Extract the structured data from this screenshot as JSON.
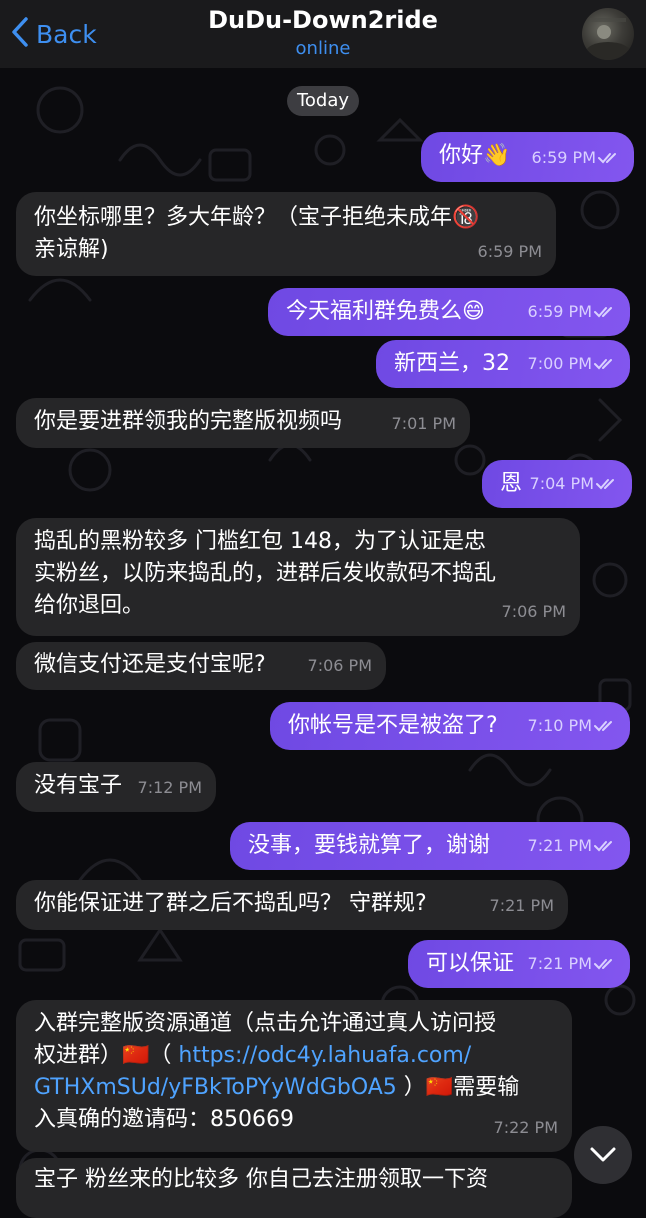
{
  "header": {
    "back_label": "Back",
    "title": "DuDu-Down2ride",
    "status": "online"
  },
  "date_separator": "Today",
  "messages": [
    {
      "dir": "out",
      "text": "你好👋",
      "time": "6:59 PM"
    },
    {
      "dir": "in",
      "text": "你坐标哪里？多大年龄？（宝子拒绝未成年🔞\n亲谅解)",
      "time": "6:59 PM"
    },
    {
      "dir": "out",
      "text": "今天福利群免费么😄",
      "time": "6:59 PM"
    },
    {
      "dir": "out",
      "text": "新西兰，32",
      "time": "7:00 PM"
    },
    {
      "dir": "in",
      "text": "你是要进群领我的完整版视频吗",
      "time": "7:01 PM"
    },
    {
      "dir": "out",
      "text": "恩",
      "time": "7:04 PM"
    },
    {
      "dir": "in",
      "text": "捣乱的黑粉较多 门槛红包 148，为了认证是忠\n实粉丝，以防来捣乱的，进群后发收款码不捣乱\n给你退回。",
      "time": "7:06 PM"
    },
    {
      "dir": "in",
      "text": "微信支付还是支付宝呢?",
      "time": "7:06 PM"
    },
    {
      "dir": "out",
      "text": "你帐号是不是被盗了?",
      "time": "7:10 PM"
    },
    {
      "dir": "in",
      "text": "没有宝子",
      "time": "7:12 PM"
    },
    {
      "dir": "out",
      "text": "没事，要钱就算了，谢谢",
      "time": "7:21 PM"
    },
    {
      "dir": "in",
      "text": "你能保证进了群之后不捣乱吗？ 守群规?",
      "time": "7:21 PM"
    },
    {
      "dir": "out",
      "text": "可以保证",
      "time": "7:21 PM"
    },
    {
      "dir": "in",
      "text_line1": "入群完整版资源通道（点击允许通过真人访问授",
      "text_line2_prefix": "权进群）🇨🇳（ ",
      "link_part1": "https://odc4y.lahuafa.com/",
      "link_part2": "GTHXmSUd/yFBkToPYyWdGbOA5",
      "text_after_link": " ）🇨🇳需要输",
      "text_line4": "入真确的邀请码：850669",
      "time": "7:22 PM"
    },
    {
      "dir": "in",
      "text": "宝子 粉丝来的比较多 你自己去注册领取一下资",
      "time": ""
    }
  ],
  "colors": {
    "accent": "#3e8ff0",
    "outgoing_bubble": "#7a50ea",
    "incoming_bubble": "#262628",
    "link": "#4fa3ff"
  },
  "icons": {
    "back": "chevron-left-icon",
    "read_receipt": "double-check-icon",
    "scroll_down": "chevron-down-icon"
  }
}
